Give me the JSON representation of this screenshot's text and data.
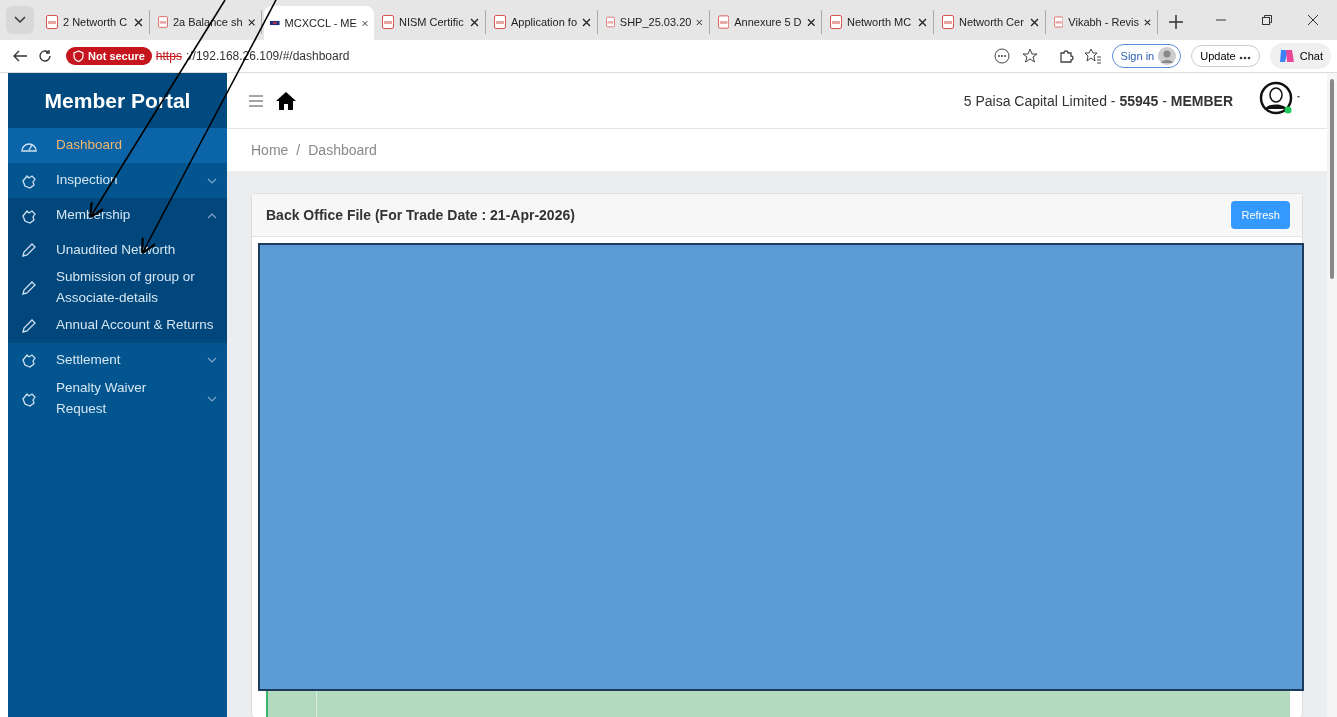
{
  "browser": {
    "tabs": [
      {
        "label": "2 Networth C",
        "selected": false,
        "kind": "pdf"
      },
      {
        "label": "2a Balance sh",
        "selected": false,
        "kind": "pdf"
      },
      {
        "label": "MCXCCL - ME",
        "selected": true,
        "kind": "site"
      },
      {
        "label": "NISM Certific",
        "selected": false,
        "kind": "pdf"
      },
      {
        "label": "Application fo",
        "selected": false,
        "kind": "pdf"
      },
      {
        "label": "SHP_25.03.20",
        "selected": false,
        "kind": "pdf"
      },
      {
        "label": "Annexure 5 D",
        "selected": false,
        "kind": "pdf"
      },
      {
        "label": "Networth MC",
        "selected": false,
        "kind": "pdf"
      },
      {
        "label": "Networth Cer",
        "selected": false,
        "kind": "pdf"
      },
      {
        "label": "Vikabh - Revis",
        "selected": false,
        "kind": "pdf"
      }
    ],
    "security_badge": "Not secure",
    "url_scheme": "https",
    "url_rest": "://192.168.26.109/#/dashboard",
    "sign_in": "Sign in",
    "update": "Update",
    "chat": "Chat"
  },
  "sidebar": {
    "title": "Member Portal",
    "items": [
      {
        "label": "Dashboard",
        "kind": "dashboard",
        "selected": true
      },
      {
        "label": "Inspection",
        "kind": "section",
        "selected": false,
        "expanded": false
      },
      {
        "label": "Membership",
        "kind": "section",
        "selected": false,
        "expanded": true,
        "children": [
          {
            "label": "Unaudited Networth",
            "kind": "sub",
            "selected": false
          },
          {
            "label": "Submission of group or Associate-details",
            "kind": "sub",
            "selected": false
          },
          {
            "label": "Annual Account & Returns",
            "kind": "sub",
            "selected": false
          }
        ]
      },
      {
        "label": "Settlement",
        "kind": "section",
        "selected": false,
        "expanded": false
      },
      {
        "label": "Penalty Waiver Request",
        "kind": "section",
        "selected": false,
        "expanded": false
      }
    ]
  },
  "header": {
    "company": "5 Paisa Capital Limited - ",
    "member_code": "55945",
    "separator": " - ",
    "role": "MEMBER"
  },
  "breadcrumb": {
    "items": [
      "Home",
      "Dashboard"
    ],
    "separator": "/"
  },
  "card": {
    "title": "Back Office File (For Trade Date : 21-Apr-2026)",
    "refresh_button": "Refresh"
  }
}
